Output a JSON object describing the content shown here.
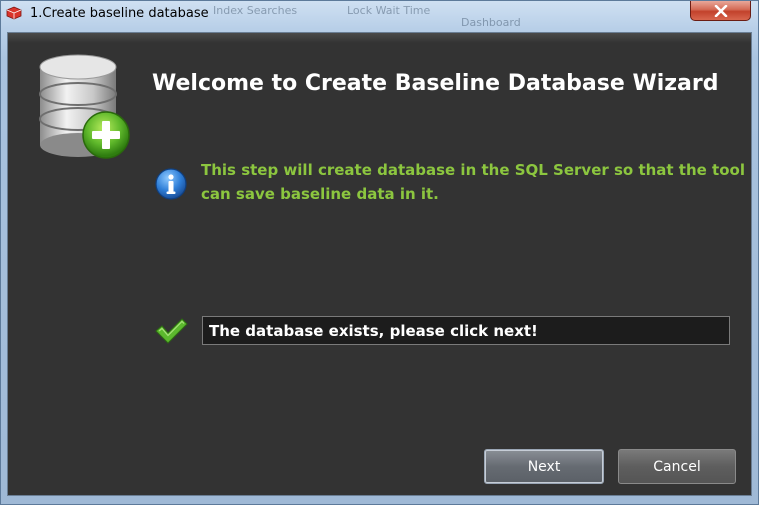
{
  "window": {
    "title": "1.Create baseline database",
    "close_icon": "close-icon"
  },
  "background_tabs": [
    "Index Searches",
    "Lock Wait Time",
    "Dashboard"
  ],
  "wizard": {
    "heading": "Welcome to Create Baseline Database Wizard",
    "info_text": "This step will create database in the SQL Server so that the tool can save baseline data in it.",
    "status_text": "The database exists, please click next!",
    "icons": {
      "database": "database-add-icon",
      "info": "info-icon",
      "status": "checkmark-icon"
    }
  },
  "buttons": {
    "next_label": "Next",
    "cancel_label": "Cancel"
  },
  "colors": {
    "client_background": "#333333",
    "info_text": "#8cc63f",
    "heading_text": "#ffffff",
    "close_button": "#c2412b"
  }
}
